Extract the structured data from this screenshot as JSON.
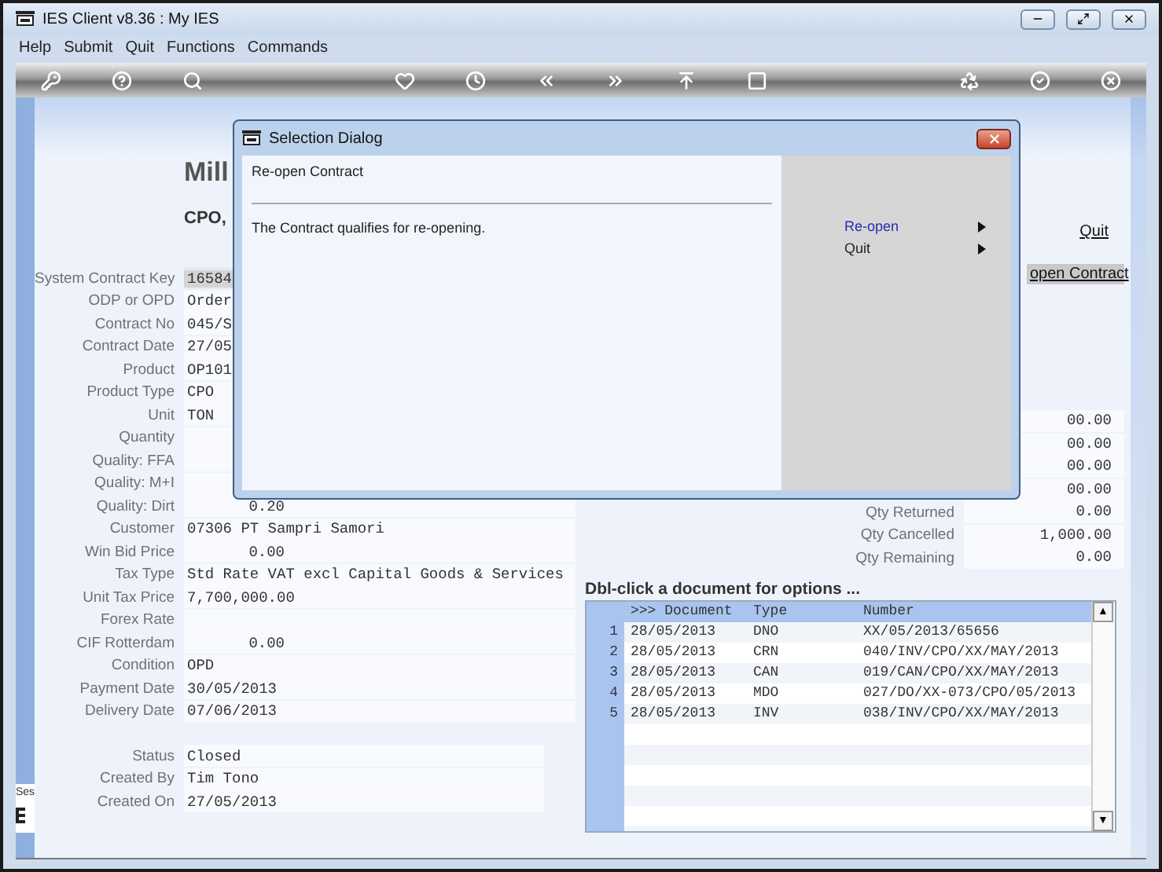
{
  "window": {
    "title": "IES Client v8.36 : My IES"
  },
  "menu": [
    "Help",
    "Submit",
    "Quit",
    "Functions",
    "Commands"
  ],
  "heading": {
    "title": "Mill",
    "subtitle": "CPO,"
  },
  "quit_link": "Quit",
  "reopen_button": "open Contract",
  "fields": [
    {
      "label": "System Contract Key",
      "value": "16584",
      "kind": "text",
      "focused": true
    },
    {
      "label": "ODP or OPD",
      "value": "Order",
      "kind": "text",
      "focused": false
    },
    {
      "label": "Contract No",
      "value": "045/S",
      "kind": "text",
      "focused": false
    },
    {
      "label": "Contract Date",
      "value": "27/05",
      "kind": "text",
      "focused": false
    },
    {
      "label": "Product",
      "value": "OP101",
      "kind": "text",
      "focused": false
    },
    {
      "label": "Product Type",
      "value": "CPO",
      "kind": "text",
      "focused": false
    },
    {
      "label": "Unit",
      "value": "TON",
      "kind": "text",
      "focused": false
    },
    {
      "label": "Quantity",
      "focused": false
    },
    {
      "label": "Quality: FFA",
      "focused": false
    },
    {
      "label": "Quality: M+I",
      "focused": false
    },
    {
      "label": "Quality: Dirt",
      "value": "0.20",
      "kind": "number",
      "focused": false
    },
    {
      "label": "Customer",
      "value": "07306 PT Sampri Samori",
      "kind": "text",
      "focused": false
    },
    {
      "label": "Win Bid Price",
      "value": "0.00",
      "kind": "number",
      "focused": false
    },
    {
      "label": "Tax Type",
      "value": "Std Rate VAT excl Capital Goods & Services",
      "kind": "text",
      "focused": false
    },
    {
      "label": "Unit Tax Price",
      "value": "7,700,000.00",
      "kind": "number",
      "focused": false
    },
    {
      "label": "Forex Rate",
      "focused": false
    },
    {
      "label": "CIF Rotterdam",
      "value": "0.00",
      "kind": "number",
      "focused": false
    },
    {
      "label": "Condition",
      "value": "OPD",
      "kind": "text",
      "focused": false
    },
    {
      "label": "Payment Date",
      "value": "30/05/2013",
      "kind": "text",
      "focused": false
    },
    {
      "label": "Delivery Date",
      "value": "07/06/2013",
      "kind": "text",
      "focused": false
    }
  ],
  "status_fields": [
    {
      "label": "Status",
      "value": "Closed"
    },
    {
      "label": "Created By",
      "value": "Tim Tono"
    },
    {
      "label": "Created On",
      "value": "27/05/2013"
    }
  ],
  "quantities": [
    {
      "value": "00.00"
    },
    {
      "value": "00.00"
    },
    {
      "value": "00.00"
    },
    {
      "value": "00.00"
    },
    {
      "label": "Qty Returned",
      "value": "0.00"
    },
    {
      "label": "Qty Cancelled",
      "value": "1,000.00"
    },
    {
      "label": "Qty Remaining",
      "value": "0.00"
    }
  ],
  "documents": {
    "caption": "Dbl-click a document for options ...",
    "columns": [
      ">>> Document",
      "Type",
      "Number"
    ],
    "scroll_arrows": [
      "▲",
      "▼"
    ],
    "rows": [
      {
        "n": "1",
        "date": "28/05/2013",
        "type": "DNO",
        "number": "XX/05/2013/65656"
      },
      {
        "n": "2",
        "date": "28/05/2013",
        "type": "CRN",
        "number": "040/INV/CPO/XX/MAY/2013"
      },
      {
        "n": "3",
        "date": "28/05/2013",
        "type": "CAN",
        "number": "019/CAN/CPO/XX/MAY/2013"
      },
      {
        "n": "4",
        "date": "28/05/2013",
        "type": "MDO",
        "number": "027/DO/XX-073/CPO/05/2013"
      },
      {
        "n": "5",
        "date": "28/05/2013",
        "type": "INV",
        "number": "038/INV/CPO/XX/MAY/2013"
      }
    ]
  },
  "side_panel": {
    "label": "Ses"
  },
  "dialog": {
    "title": "Selection Dialog",
    "heading": "Re-open Contract",
    "message": "The Contract qualifies for re-opening.",
    "options": [
      {
        "label": "Re-open",
        "selected": true
      },
      {
        "label": "Quit",
        "selected": false
      }
    ]
  }
}
